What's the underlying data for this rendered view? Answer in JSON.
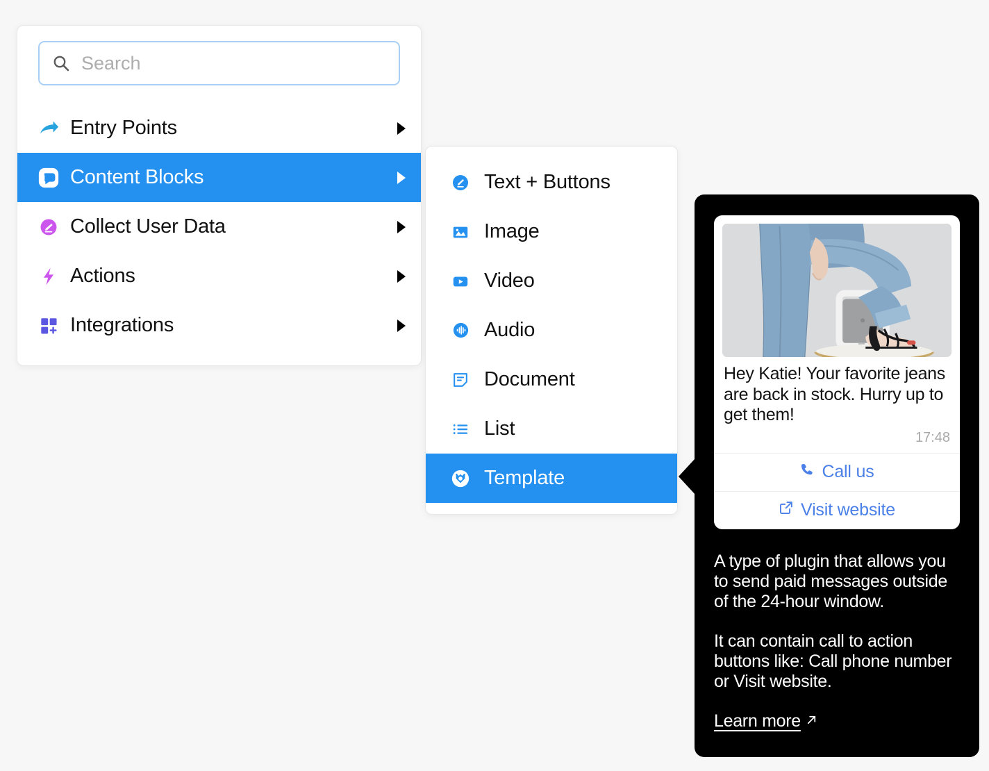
{
  "search": {
    "placeholder": "Search",
    "value": "",
    "icon": "search-icon"
  },
  "menu": {
    "items": [
      {
        "label": "Entry Points",
        "icon": "arrow-share-icon",
        "icon_color": "#29a3dd",
        "selected": false,
        "has_submenu": true
      },
      {
        "label": "Content Blocks",
        "icon": "chat-bubble-icon",
        "icon_color": "#ffffff",
        "selected": true,
        "has_submenu": true
      },
      {
        "label": "Collect User Data",
        "icon": "pencil-circle-icon",
        "icon_color": "#cc55ee",
        "selected": false,
        "has_submenu": true
      },
      {
        "label": "Actions",
        "icon": "lightning-bolt-icon",
        "icon_color": "#cc55ee",
        "selected": false,
        "has_submenu": true
      },
      {
        "label": "Integrations",
        "icon": "grid-plus-icon",
        "icon_color": "#5b57e0",
        "selected": false,
        "has_submenu": true
      }
    ]
  },
  "submenu": {
    "items": [
      {
        "label": "Text + Buttons",
        "icon": "pencil-circle-icon",
        "selected": false
      },
      {
        "label": "Image",
        "icon": "image-icon",
        "selected": false
      },
      {
        "label": "Video",
        "icon": "video-play-icon",
        "selected": false
      },
      {
        "label": "Audio",
        "icon": "audio-wave-icon",
        "selected": false
      },
      {
        "label": "Document",
        "icon": "document-icon",
        "selected": false
      },
      {
        "label": "List",
        "icon": "list-icon",
        "selected": false
      },
      {
        "label": "Template",
        "icon": "template-badge-icon",
        "selected": true
      }
    ]
  },
  "preview": {
    "message": {
      "image_alt": "woman-in-jeans-on-chair-photo",
      "text": "Hey Katie! Your favorite jeans are back in stock. Hurry up to get them!",
      "time": "17:48",
      "buttons": [
        {
          "label": "Call us",
          "icon": "phone-icon"
        },
        {
          "label": "Visit website",
          "icon": "external-link-icon"
        }
      ]
    },
    "description_1": "A type of plugin that allows you to send paid messages outside of the 24-hour window.",
    "description_2": "It can contain call to action buttons like: Call phone number or Visit website.",
    "learn_more": "Learn more",
    "learn_more_icon": "arrow-up-right-icon"
  },
  "colors": {
    "accent_blue": "#2490ef",
    "link_blue": "#4a80e8",
    "panel_black": "#000000",
    "page_bg": "#f7f7f7"
  }
}
